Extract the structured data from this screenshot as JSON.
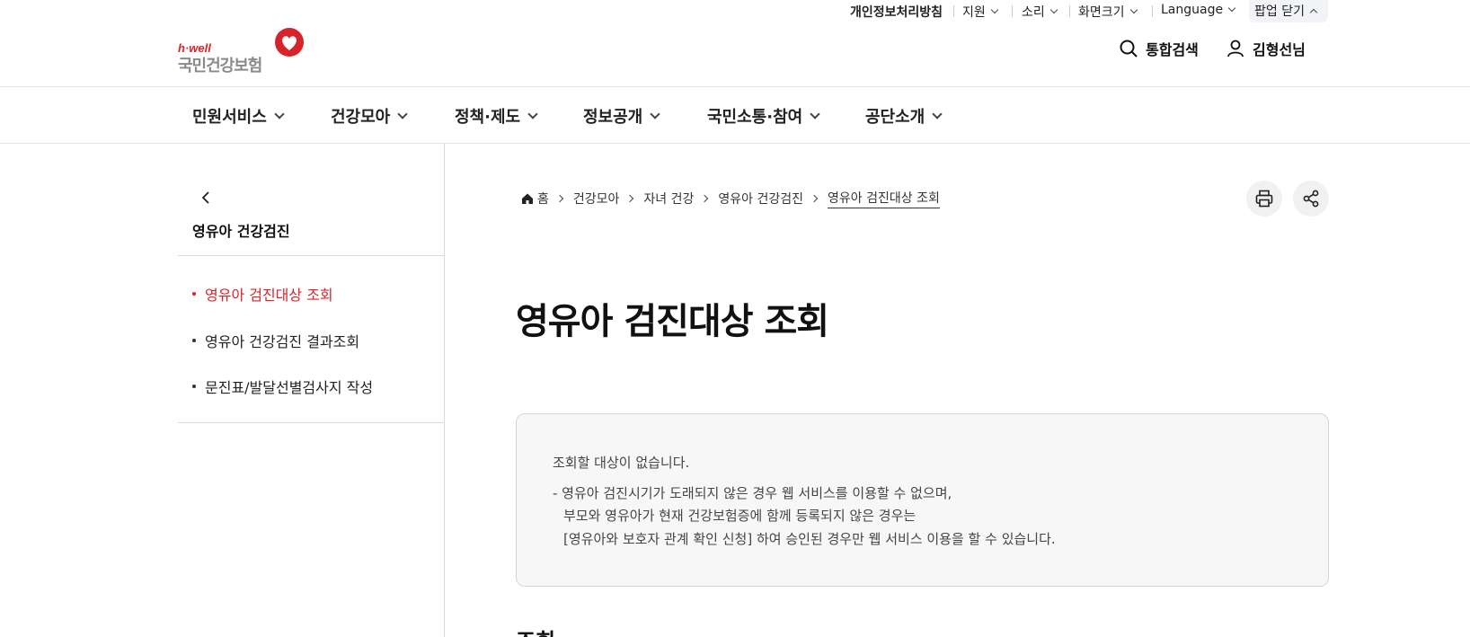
{
  "utility": {
    "privacy": "개인정보처리방침",
    "support": "지원",
    "sound": "소리",
    "screen_size": "화면크기",
    "language": "Language",
    "popup_close": "팝업 닫기"
  },
  "logo": {
    "tagline": "h·well",
    "name": "국민건강보험"
  },
  "header": {
    "search": "통합검색",
    "user": "김형선님"
  },
  "gnb": [
    {
      "label": "민원서비스"
    },
    {
      "label": "건강모아"
    },
    {
      "label": "정책·제도"
    },
    {
      "label": "정보공개"
    },
    {
      "label": "국민소통·참여"
    },
    {
      "label": "공단소개"
    }
  ],
  "sidebar": {
    "title": "영유아 건강검진",
    "items": [
      {
        "label": "영유아 검진대상 조회",
        "active": true
      },
      {
        "label": "영유아 건강검진 결과조회"
      },
      {
        "label": "문진표/발달선별검사지 작성"
      }
    ]
  },
  "breadcrumb": [
    "홈",
    "건강모아",
    "자녀 건강",
    "영유아 건강검진",
    "영유아 검진대상 조회"
  ],
  "main": {
    "title": "영유아 검진대상 조회",
    "notice": {
      "line1": "조회할 대상이 없습니다.",
      "line2": "- 영유아 검진시기가 도래되지 않은 경우 웹 서비스를 이용할 수 없으며,",
      "line3": "부모와 영유아가 현재 건강보험증에 함께 등록되지 않은 경우는",
      "line4": "[영유아와 보호자 관계 확인 신청] 하여 승인된 경우만 웹 서비스 이용을 할 수 있습니다."
    },
    "section_title": "조회"
  },
  "colors": {
    "accent": "#d8232a",
    "text": "#222222",
    "muted": "#8a8a8a"
  }
}
